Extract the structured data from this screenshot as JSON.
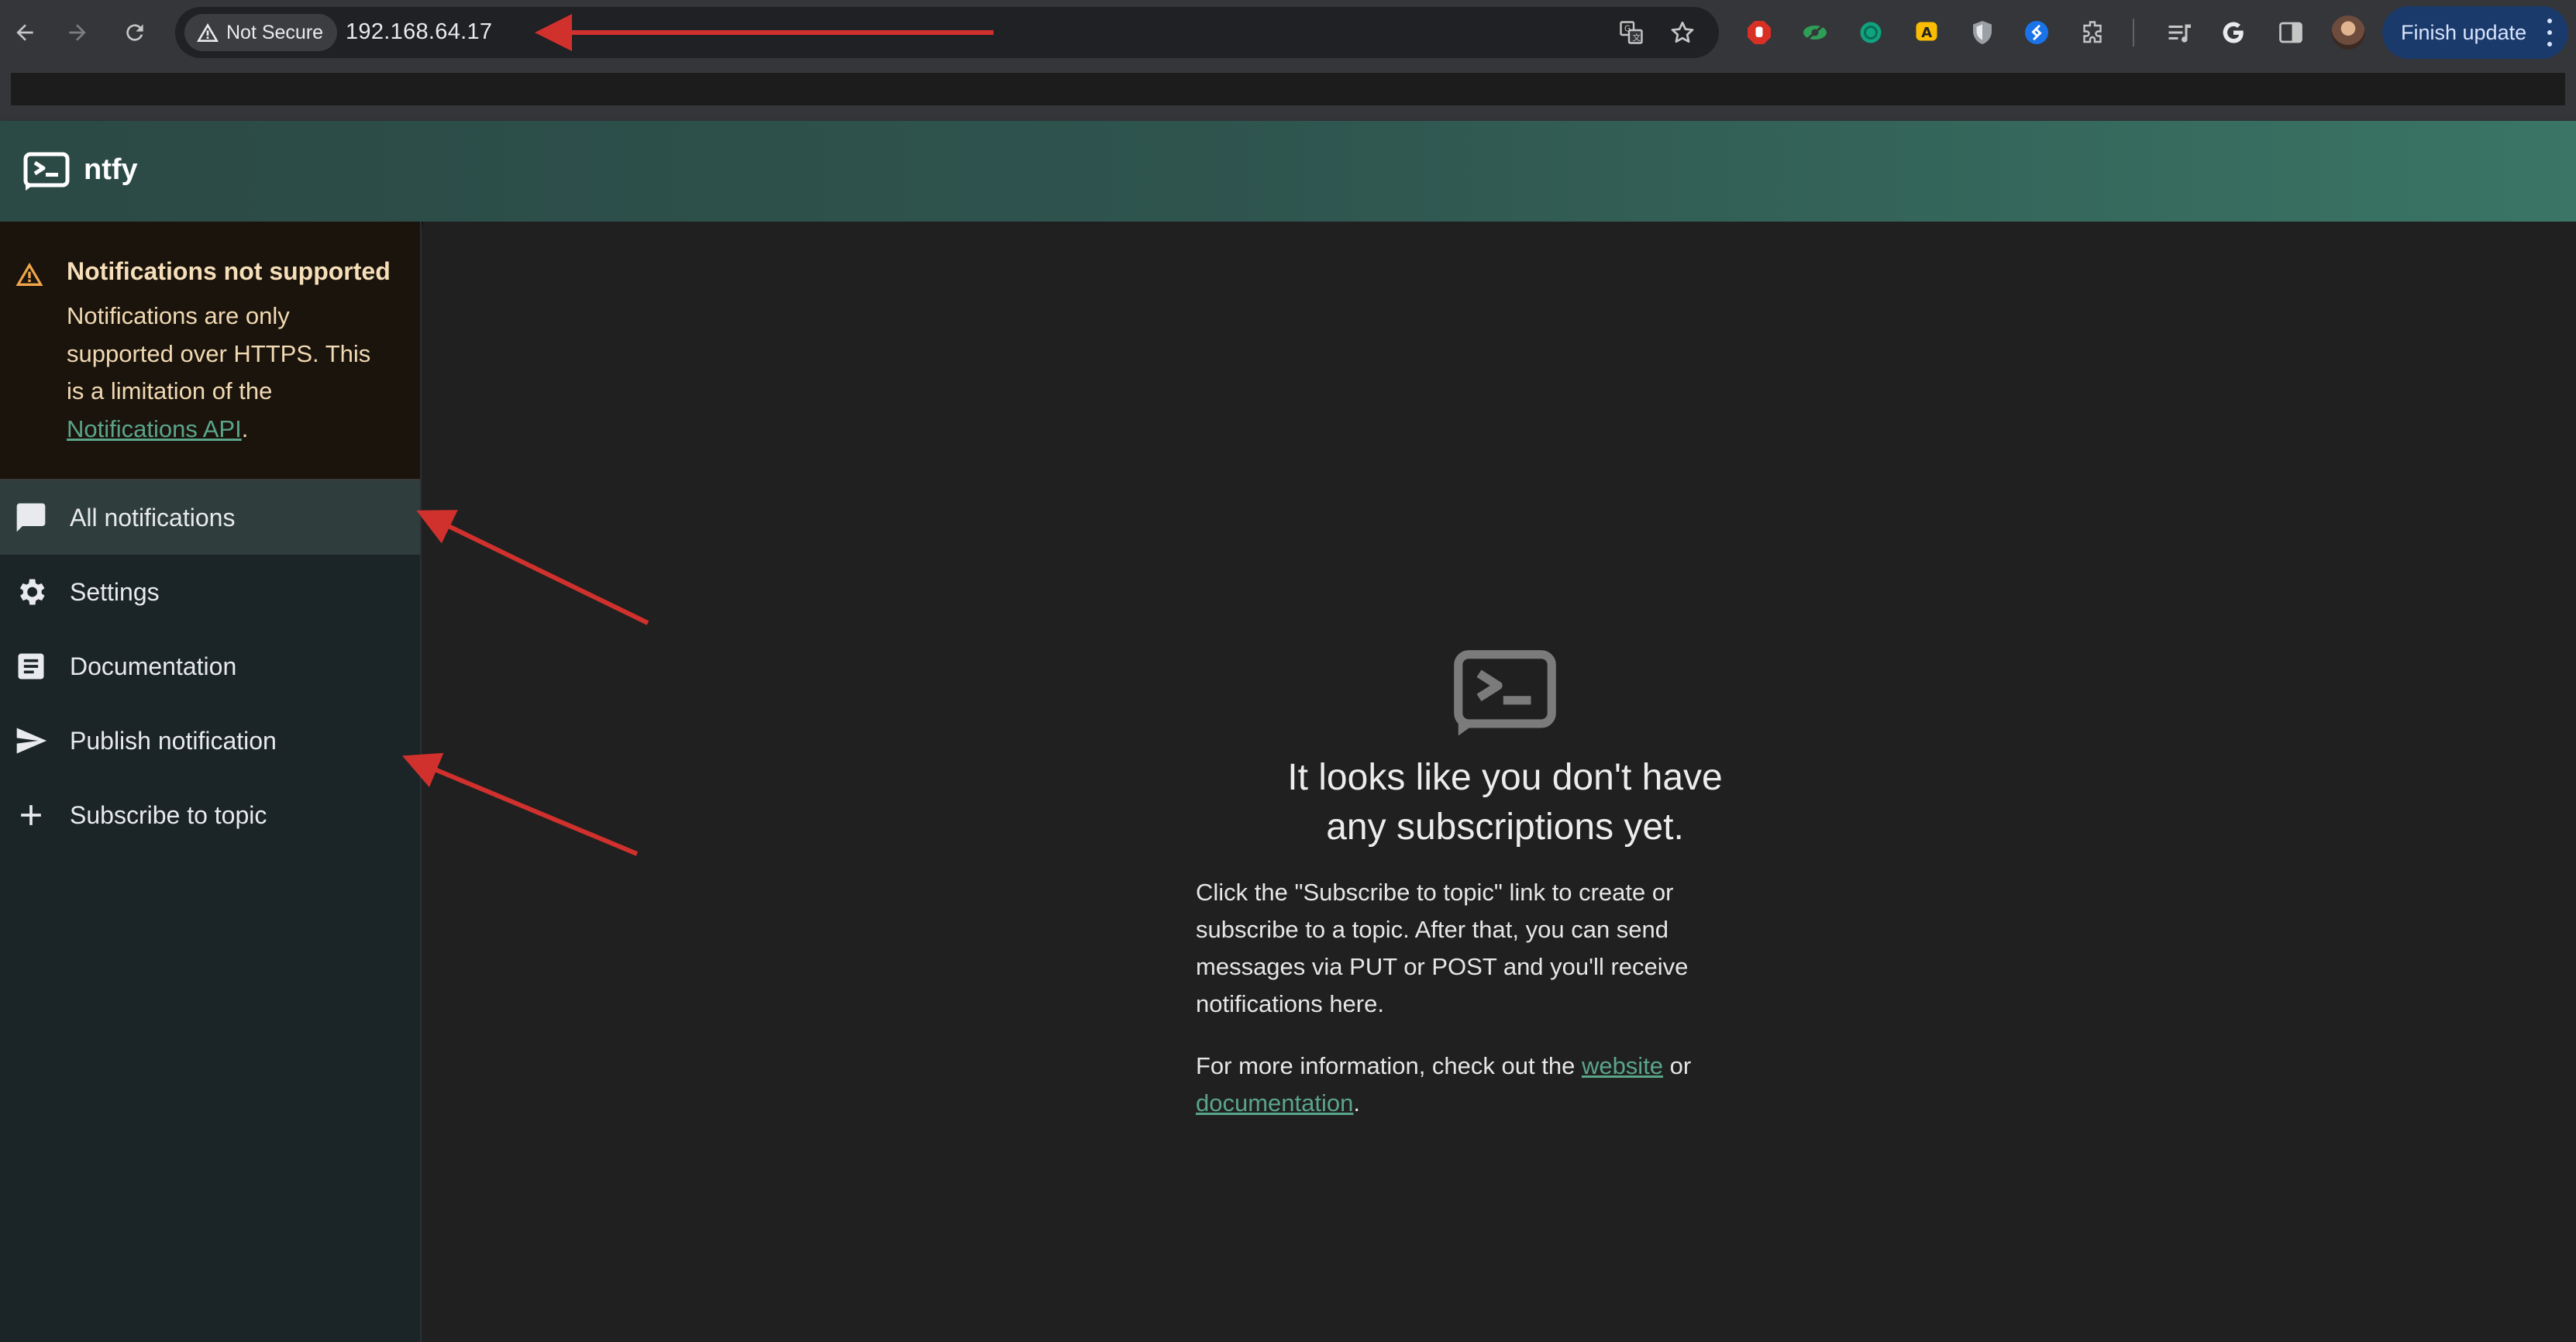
{
  "browser": {
    "security_label": "Not Secure",
    "url": "192.168.64.17",
    "update_button": "Finish update",
    "icons": [
      "back-icon",
      "forward-icon",
      "reload-icon",
      "warning-icon",
      "translate-icon",
      "bookmark-star-icon",
      "extensions-icon",
      "reading-list-icon",
      "google-icon",
      "side-panel-icon"
    ]
  },
  "app": {
    "title": "ntfy"
  },
  "alert": {
    "title": "Notifications not supported",
    "body_prefix": "Notifications are only supported over HTTPS. This is a limitation of the ",
    "link": "Notifications API",
    "body_suffix": "."
  },
  "sidebar": {
    "items": [
      {
        "label": "All notifications",
        "icon": "chat-icon",
        "active": true
      },
      {
        "label": "Settings",
        "icon": "gear-icon",
        "active": false
      },
      {
        "label": "Documentation",
        "icon": "article-icon",
        "active": false
      },
      {
        "label": "Publish notification",
        "icon": "send-icon",
        "active": false
      },
      {
        "label": "Subscribe to topic",
        "icon": "plus-icon",
        "active": false
      }
    ]
  },
  "empty_state": {
    "title": "It looks like you don't have any subscriptions yet.",
    "body": "Click the \"Subscribe to topic\" link to create or subscribe to a topic. After that, you can send messages via PUT or POST and you'll receive notifications here.",
    "more_prefix": "For more information, check out the ",
    "website_link": "website",
    "more_middle": " or ",
    "docs_link": "documentation",
    "more_suffix": "."
  },
  "colors": {
    "accent": "#338574",
    "annotation_arrow": "#d0312d",
    "alert_bg": "#1b140c",
    "drawer_bg": "#1b2426"
  }
}
